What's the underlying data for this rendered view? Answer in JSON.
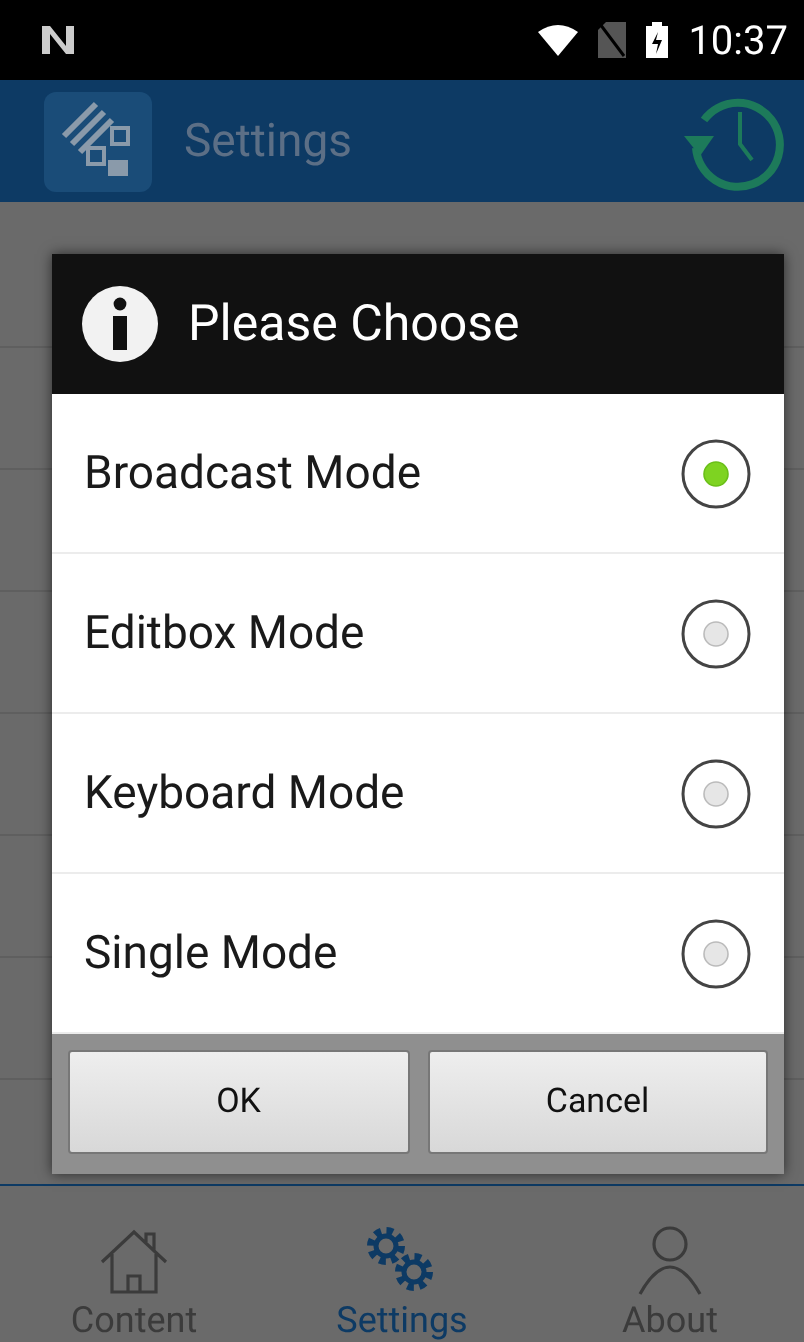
{
  "status_bar": {
    "time": "10:37"
  },
  "app_bar": {
    "title": "Settings"
  },
  "dialog": {
    "title": "Please Choose",
    "options": [
      {
        "label": "Broadcast Mode",
        "selected": true
      },
      {
        "label": "Editbox Mode",
        "selected": false
      },
      {
        "label": "Keyboard Mode",
        "selected": false
      },
      {
        "label": "Single Mode",
        "selected": false
      }
    ],
    "buttons": [
      "OK",
      "Cancel"
    ]
  },
  "bottom_nav": [
    {
      "label": "Content",
      "kind": "home",
      "selected": false
    },
    {
      "label": "Settings",
      "kind": "gears",
      "selected": true
    },
    {
      "label": "About",
      "kind": "person",
      "selected": false
    }
  ]
}
